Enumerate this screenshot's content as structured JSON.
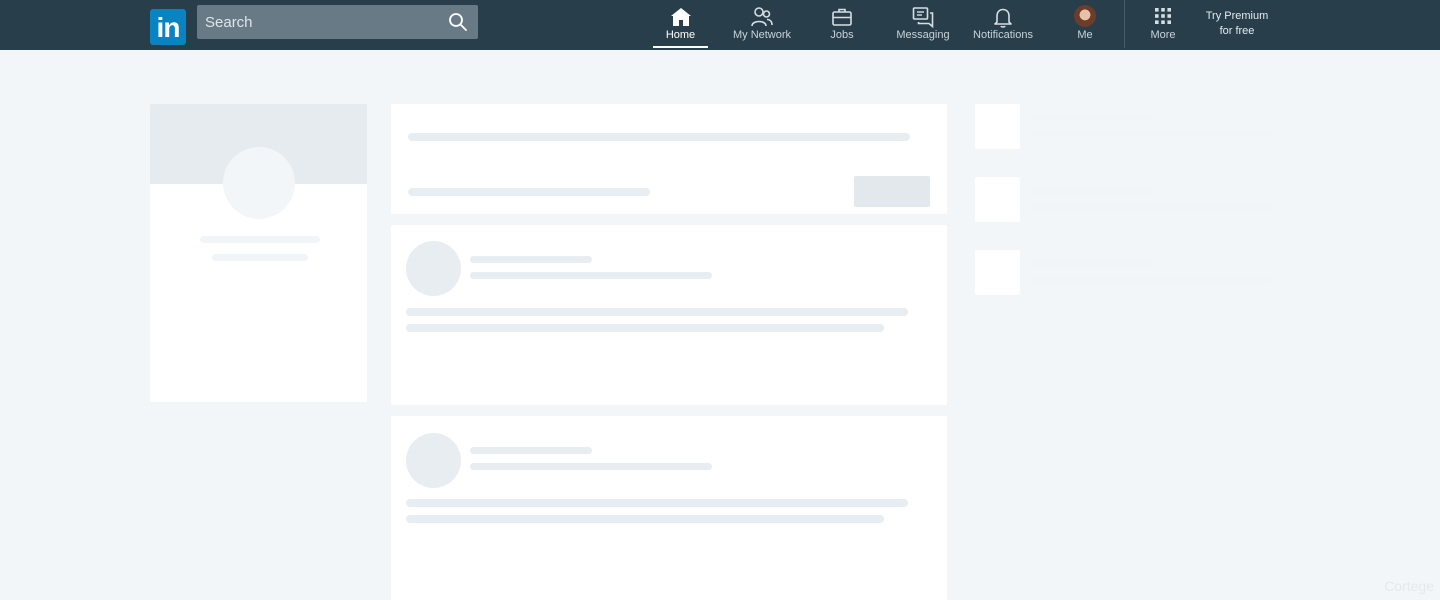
{
  "navbar": {
    "logo_text": "in",
    "search": {
      "placeholder": "Search",
      "icon": "search-icon"
    },
    "items": [
      {
        "label": "Home",
        "icon": "home-icon",
        "active": true
      },
      {
        "label": "My Network",
        "icon": "people-icon",
        "active": false
      },
      {
        "label": "Jobs",
        "icon": "briefcase-icon",
        "active": false
      },
      {
        "label": "Messaging",
        "icon": "chat-icon",
        "active": false
      },
      {
        "label": "Notifications",
        "icon": "bell-icon",
        "active": false
      },
      {
        "label": "Me",
        "icon": "avatar",
        "active": false
      },
      {
        "label": "More",
        "icon": "grid-icon",
        "active": false
      }
    ],
    "premium": {
      "line1": "Try Premium",
      "line2": "for free"
    }
  },
  "colors": {
    "navbar_bg": "#283e4a",
    "logo_bg": "#0a84c1",
    "page_bg": "#f3f6f8",
    "placeholder": "#e8edf2"
  },
  "watermark": "Cortege"
}
